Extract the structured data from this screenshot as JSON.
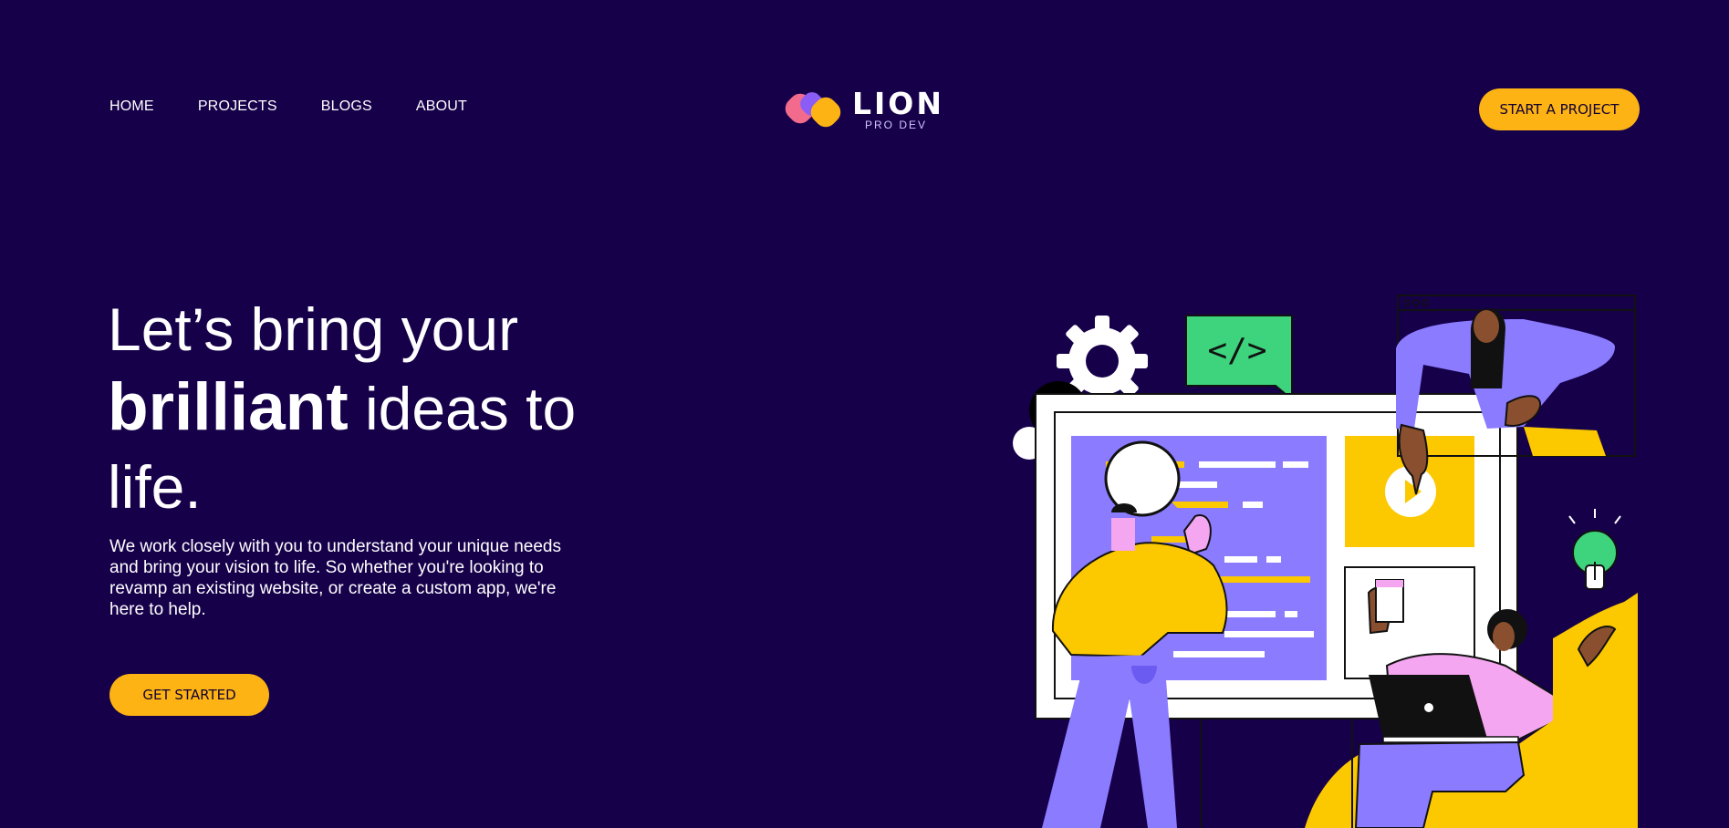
{
  "nav": {
    "items": [
      {
        "label": "HOME"
      },
      {
        "label": "PROJECTS"
      },
      {
        "label": "BLOGS"
      },
      {
        "label": "ABOUT"
      }
    ]
  },
  "logo": {
    "name": "LION",
    "tagline": "PRO DEV"
  },
  "header": {
    "cta_label": "START A PROJECT"
  },
  "hero": {
    "title_part1": "Let’s bring your",
    "title_bold": "brilliant",
    "title_part2": "ideas to life.",
    "description": "We work closely with you to understand your unique needs and bring your vision to life. So whether you're looking to revamp an existing website, or create a custom app, we're here to help.",
    "cta_label": "GET STARTED"
  },
  "illustration": {
    "code_bubble_text": "</>",
    "icons": [
      "gear-icon",
      "map-pin-icon",
      "code-bubble-icon",
      "play-icon",
      "lightbulb-icon",
      "magnifier-icon",
      "laptop-icon"
    ]
  },
  "colors": {
    "background": "#16004a",
    "accent": "#fcb313",
    "purple": "#8b7bff",
    "yellow": "#fcc800",
    "green": "#3ed37d",
    "pink": "#f4a6f0"
  }
}
